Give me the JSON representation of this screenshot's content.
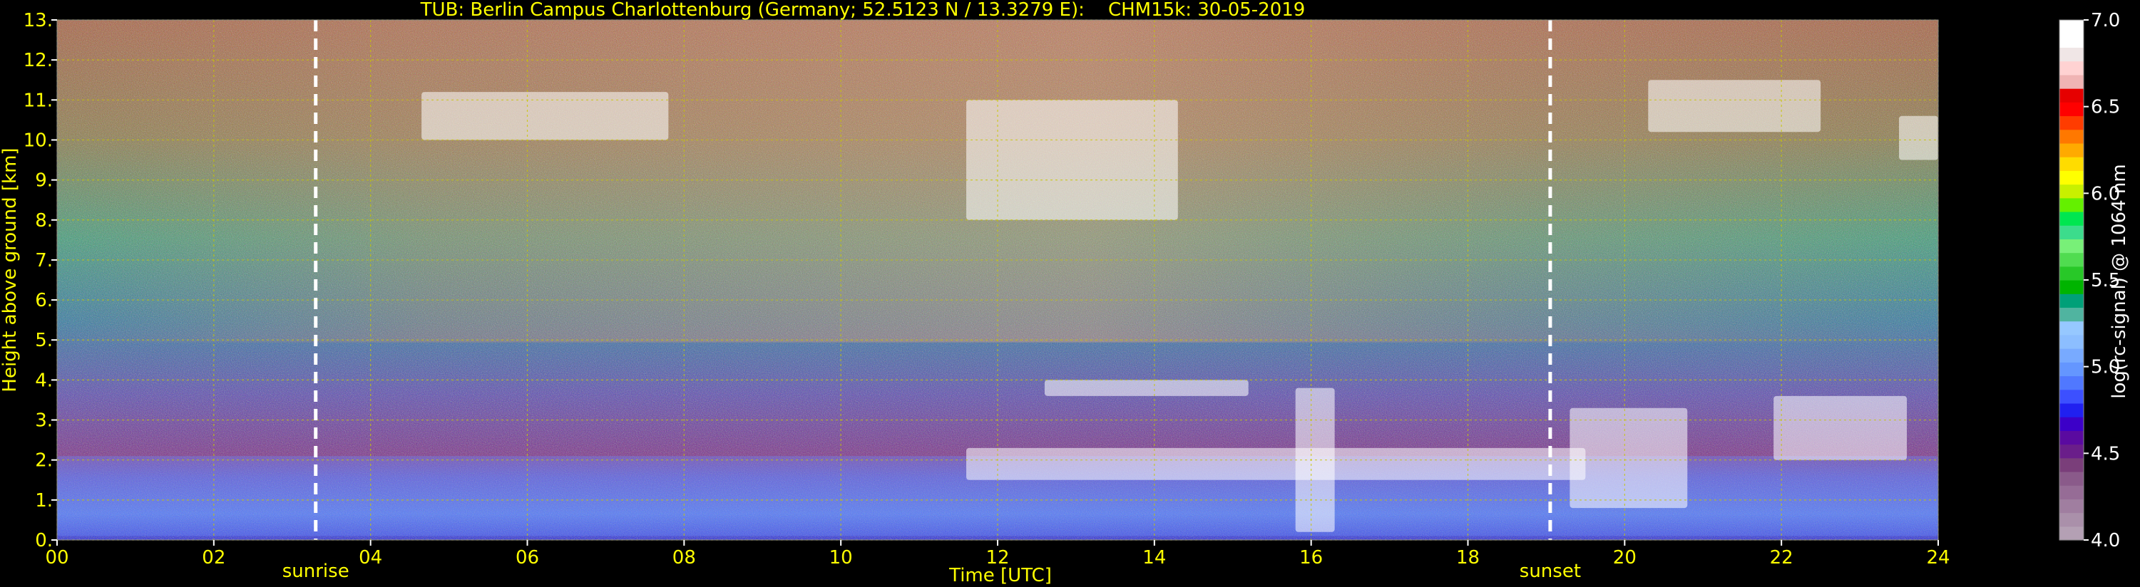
{
  "colors": {
    "background": "#000000",
    "label": "#ffff00",
    "grid": "#c8c800",
    "marker": "#ffffff",
    "cbar_label": "#ffffff"
  },
  "chart_data": {
    "type": "heatmap",
    "title": "TUB: Berlin Campus Charlottenburg (Germany; 52.5123 N / 13.3279 E):    CHM15k: 30-05-2019",
    "xlabel": "Time [UTC]",
    "ylabel": "Height above ground [km]",
    "xlim": [
      0,
      24
    ],
    "ylim": [
      0,
      13
    ],
    "xticks": [
      0,
      2,
      4,
      6,
      8,
      10,
      12,
      14,
      16,
      18,
      20,
      22,
      24
    ],
    "xtick_labels": [
      "00",
      "02",
      "04",
      "06",
      "08",
      "10",
      "12",
      "14",
      "16",
      "18",
      "20",
      "22",
      "24"
    ],
    "yticks": [
      0,
      1,
      2,
      3,
      4,
      5,
      6,
      7,
      8,
      9,
      10,
      11,
      12,
      13
    ],
    "ytick_labels": [
      "0.",
      "1.",
      "2.",
      "3.",
      "4.",
      "5.",
      "6.",
      "7.",
      "8.",
      "9.",
      "10.",
      "11.",
      "12.",
      "13."
    ],
    "grid": true,
    "markers": [
      {
        "label": "sunrise",
        "x": 3.3
      },
      {
        "label": "sunset",
        "x": 19.05
      }
    ],
    "colorbar": {
      "label": "log(rc-signal) @ 1064 nm",
      "range": [
        4.0,
        7.0
      ],
      "ticks": [
        4.0,
        4.5,
        5.0,
        5.5,
        6.0,
        6.5,
        7.0
      ],
      "tick_labels": [
        "4.0",
        "4.5",
        "5.0",
        "5.5",
        "6.0",
        "6.5",
        "7.0"
      ],
      "colors": [
        "#b4a0b4",
        "#aa90aa",
        "#a07ea0",
        "#966c96",
        "#8a5a8a",
        "#7a3e7a",
        "#6a1e8a",
        "#5a0aa0",
        "#3c00c8",
        "#2020f0",
        "#3c50ff",
        "#5078ff",
        "#6496ff",
        "#78aaff",
        "#8cbeff",
        "#96c8ff",
        "#50b4a0",
        "#00a078",
        "#00b400",
        "#28c828",
        "#50dc50",
        "#78f078",
        "#3cdc8c",
        "#00e650",
        "#64f000",
        "#c8f000",
        "#ffff00",
        "#ffdc00",
        "#ffaa00",
        "#ff7800",
        "#ff3c00",
        "#ff0000",
        "#e60000",
        "#f0b4b4",
        "#ffd2d2",
        "#f0e6e6",
        "#ffffff",
        "#ffffff"
      ]
    },
    "features": [
      {
        "name": "boundary layer",
        "x": [
          0,
          24
        ],
        "y": [
          0.1,
          2.1
        ]
      },
      {
        "name": "cloud",
        "x": [
          4.65,
          7.8
        ],
        "y": [
          10.0,
          11.2
        ]
      },
      {
        "name": "cloud",
        "x": [
          11.6,
          14.3
        ],
        "y": [
          8.0,
          11.0
        ]
      },
      {
        "name": "cloud",
        "x": [
          12.6,
          15.2
        ],
        "y": [
          3.6,
          4.0
        ]
      },
      {
        "name": "cloud",
        "x": [
          11.6,
          19.5
        ],
        "y": [
          1.5,
          2.3
        ]
      },
      {
        "name": "cloud",
        "x": [
          15.8,
          16.3
        ],
        "y": [
          0.2,
          3.8
        ]
      },
      {
        "name": "cloud",
        "x": [
          19.3,
          20.8
        ],
        "y": [
          0.8,
          3.3
        ]
      },
      {
        "name": "cloud",
        "x": [
          21.9,
          23.6
        ],
        "y": [
          2.0,
          3.6
        ]
      },
      {
        "name": "cloud",
        "x": [
          20.3,
          22.5
        ],
        "y": [
          10.2,
          11.5
        ]
      },
      {
        "name": "cloud",
        "x": [
          23.5,
          24.0
        ],
        "y": [
          9.5,
          10.6
        ]
      }
    ]
  }
}
